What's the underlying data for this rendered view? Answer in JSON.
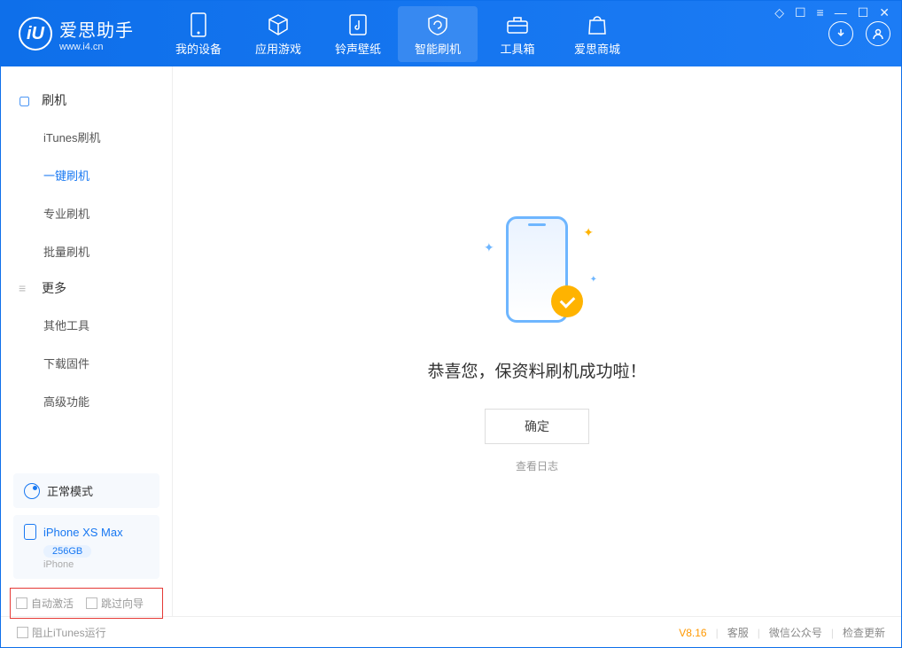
{
  "header": {
    "logo_glyph": "iU",
    "app_name": "爱思助手",
    "url": "www.i4.cn",
    "nav": [
      {
        "label": "我的设备"
      },
      {
        "label": "应用游戏"
      },
      {
        "label": "铃声壁纸"
      },
      {
        "label": "智能刷机"
      },
      {
        "label": "工具箱"
      },
      {
        "label": "爱思商城"
      }
    ]
  },
  "sidebar": {
    "group1": {
      "title": "刷机",
      "items": [
        "iTunes刷机",
        "一键刷机",
        "专业刷机",
        "批量刷机"
      ]
    },
    "group2": {
      "title": "更多",
      "items": [
        "其他工具",
        "下载固件",
        "高级功能"
      ]
    },
    "mode": "正常模式",
    "device": {
      "name": "iPhone XS Max",
      "capacity": "256GB",
      "type": "iPhone"
    },
    "checks": {
      "auto_activate": "自动激活",
      "skip_guide": "跳过向导"
    }
  },
  "main": {
    "success": "恭喜您，保资料刷机成功啦！",
    "ok": "确定",
    "view_log": "查看日志"
  },
  "footer": {
    "block_itunes": "阻止iTunes运行",
    "version": "V8.16",
    "links": [
      "客服",
      "微信公众号",
      "检查更新"
    ]
  }
}
